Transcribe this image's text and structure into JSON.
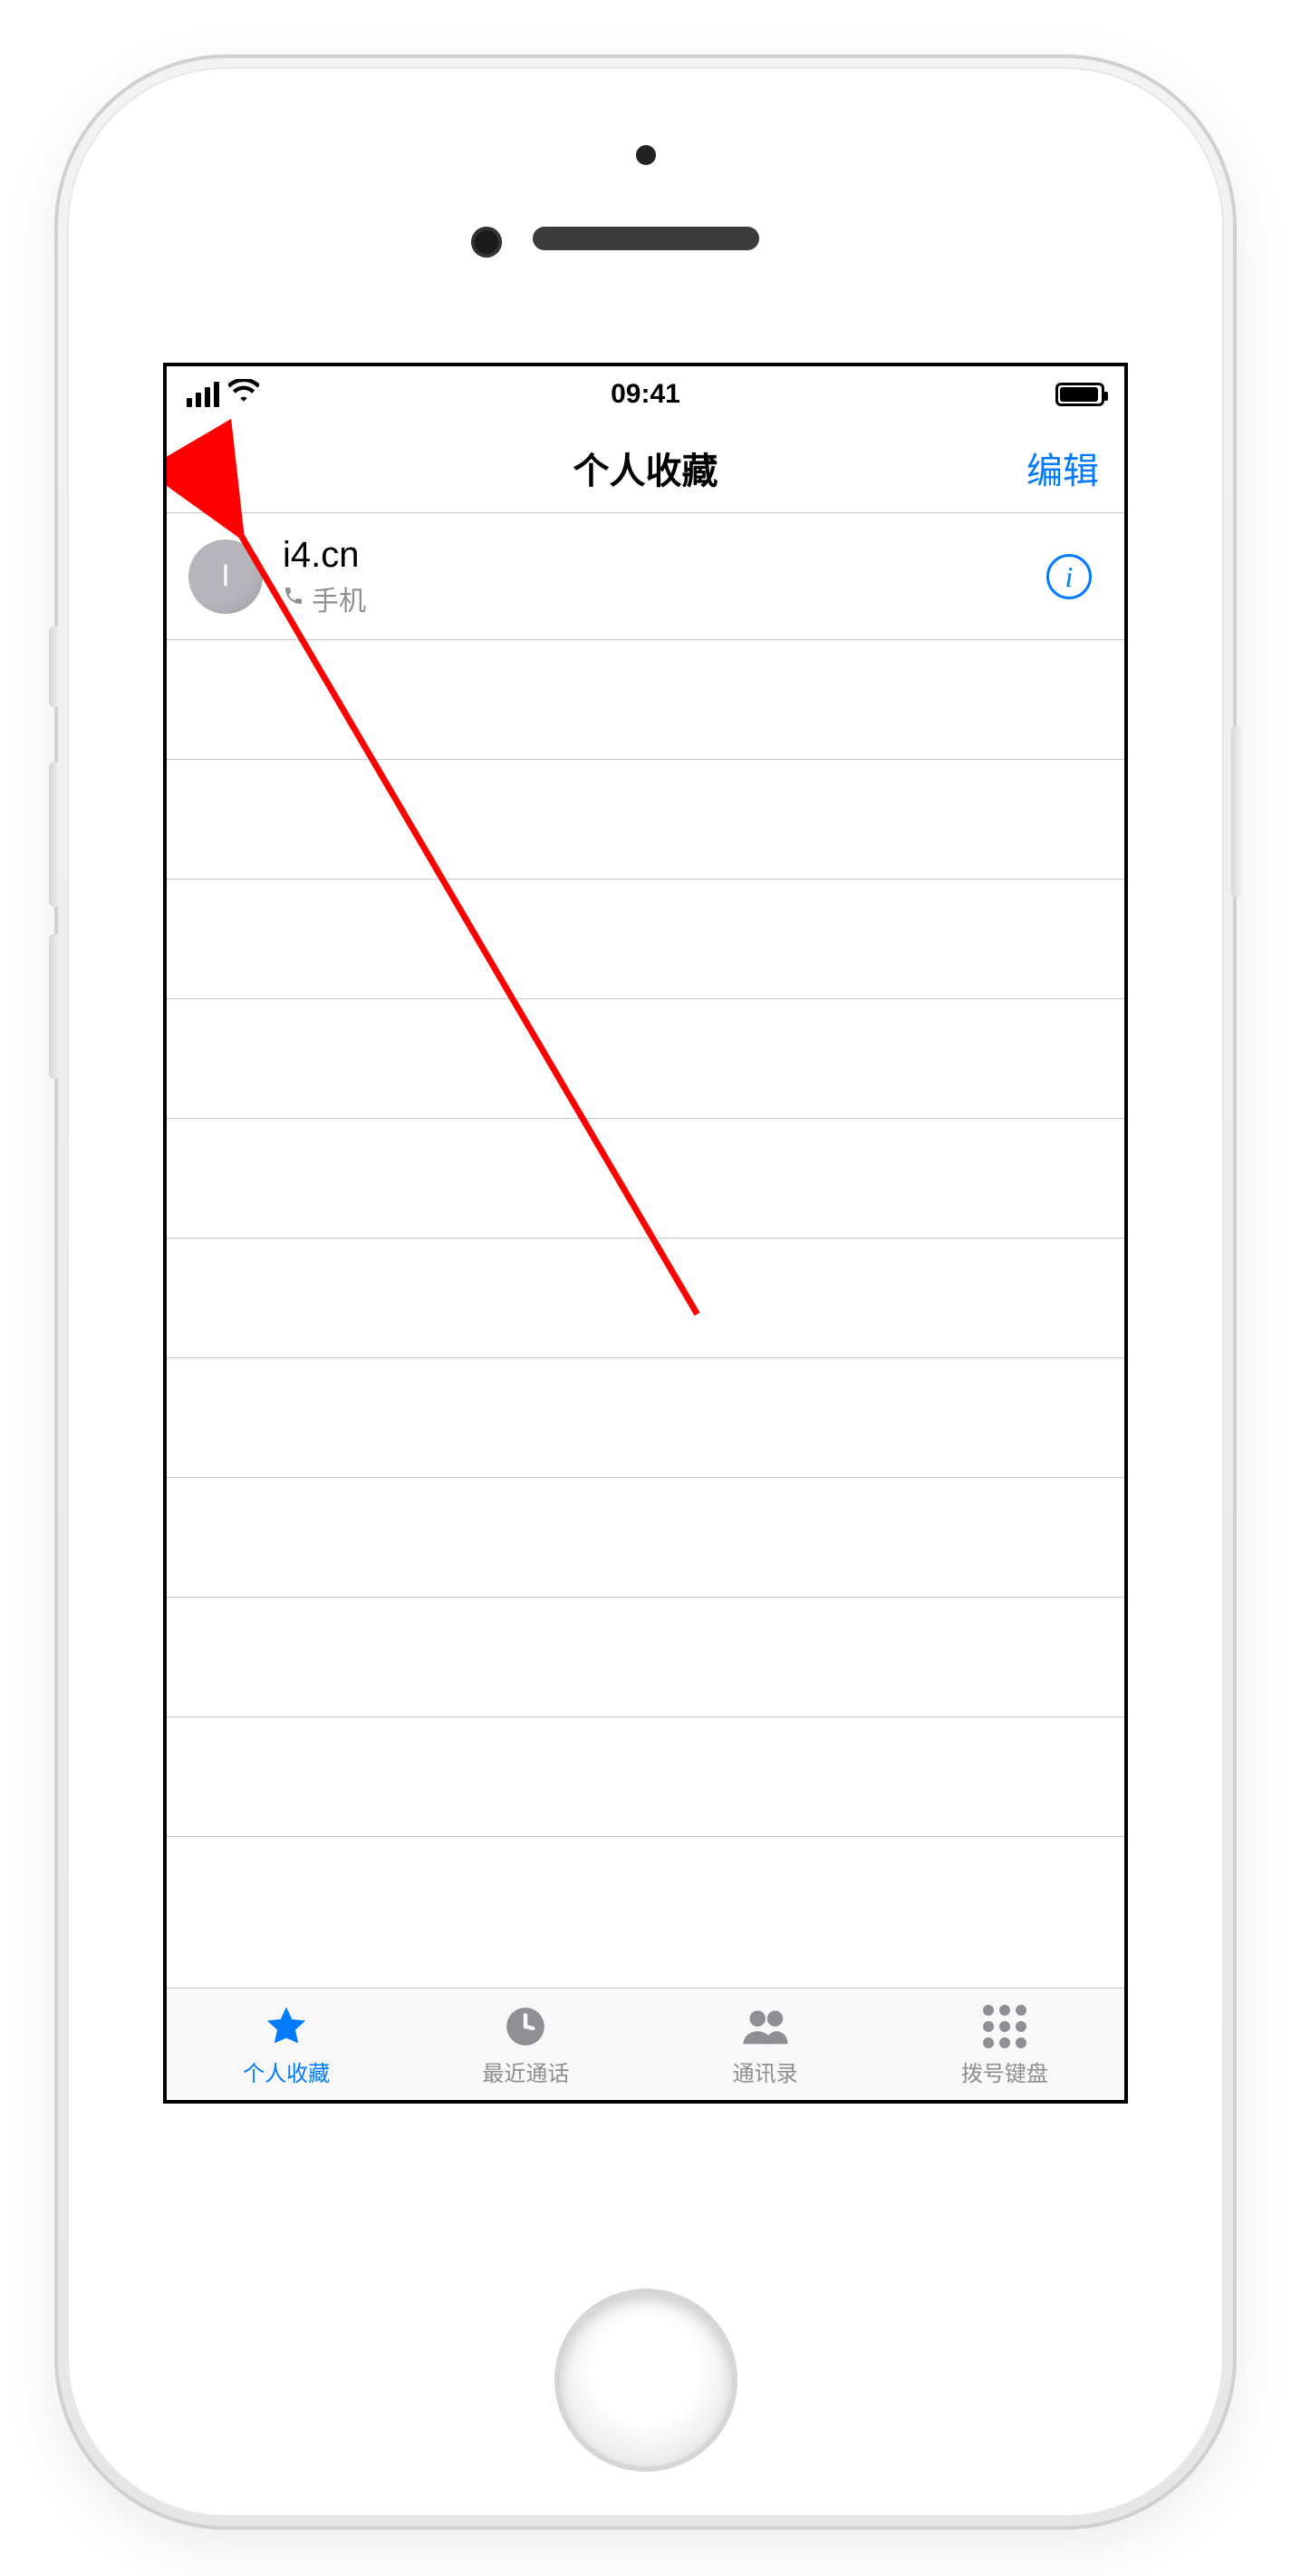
{
  "status_bar": {
    "time": "09:41"
  },
  "nav": {
    "title": "个人收藏",
    "edit": "编辑"
  },
  "favorites": [
    {
      "avatar_initial": "I",
      "name": "i4.cn",
      "type_label": "手机"
    }
  ],
  "tabs": {
    "favorites": "个人收藏",
    "recents": "最近通话",
    "contacts": "通讯录",
    "keypad": "拨号键盘"
  },
  "colors": {
    "accent_blue": "#007aff",
    "text_gray": "#8e8e93",
    "separator": "#c7c7cc",
    "annotation_red": "#ff0000"
  }
}
